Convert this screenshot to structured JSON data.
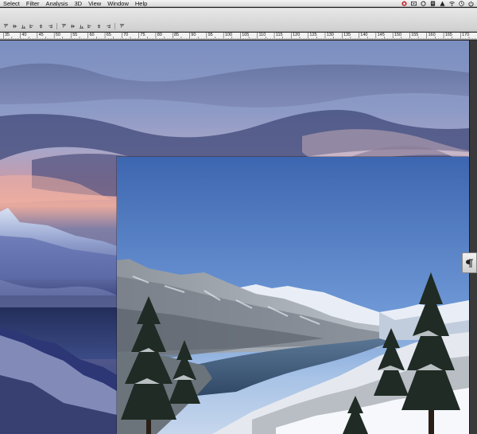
{
  "menubar": {
    "items": [
      "Select",
      "Filter",
      "Analysis",
      "3D",
      "View",
      "Window",
      "Help"
    ],
    "status_icons": [
      "creative-cloud-icon",
      "video-icon",
      "sync-icon",
      "evernote-icon",
      "adobe-icon",
      "wifi-icon",
      "clock-icon",
      "power-icon"
    ]
  },
  "ruler": {
    "labels": [
      "35",
      "40",
      "45",
      "50",
      "55",
      "60",
      "65",
      "70",
      "75",
      "80",
      "85",
      "90",
      "95",
      "100",
      "105",
      "110",
      "115",
      "120",
      "125",
      "130",
      "135",
      "140",
      "145",
      "150",
      "155",
      "160",
      "165",
      "170"
    ]
  },
  "options_bar": {
    "align_buttons": [
      "align-top-edges-icon",
      "align-vertical-centers-icon",
      "align-bottom-edges-icon",
      "align-left-edges-icon",
      "align-horizontal-centers-icon",
      "align-right-edges-icon",
      "distribute-top-icon",
      "distribute-vertical-centers-icon",
      "distribute-bottom-icon",
      "distribute-left-icon",
      "distribute-horizontal-centers-icon",
      "distribute-right-icon",
      "auto-align-icon"
    ]
  },
  "panel_tab": {
    "icon": "paragraph-panel-icon"
  },
  "colors": {
    "menubar_bg": "#e6e6e6",
    "options_bg": "#dcdcdc",
    "workspace_bg": "#2a2a2a",
    "sky_blue": "#5a6ea0",
    "sunset_pink": "#e8a6a0"
  }
}
